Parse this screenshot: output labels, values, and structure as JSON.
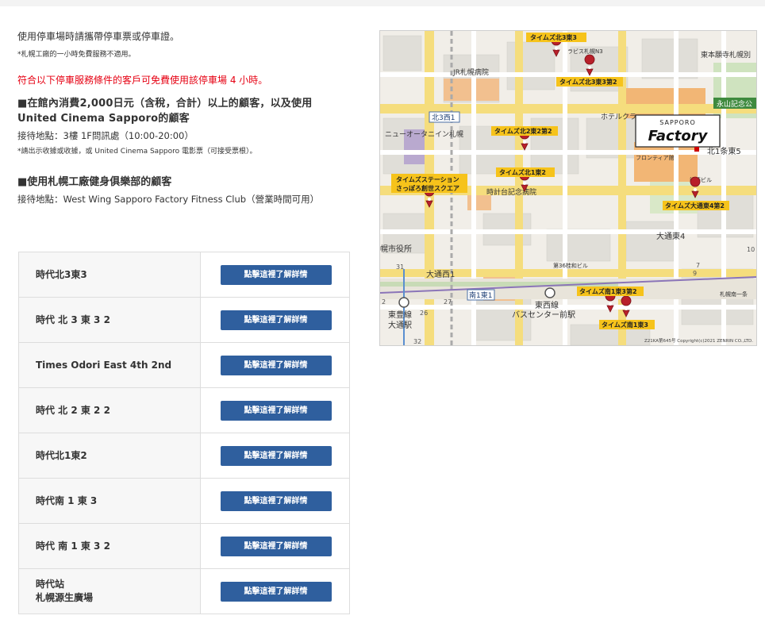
{
  "intro": {
    "line1": "使用停車場時請攜帶停車票或停車證。",
    "note1": "*札幌工廠的一小時免費服務不適用。",
    "red_notice": "符合以下停車服務條件的客戶可免費使用該停車場 4 小時。",
    "cond1_title": "■在館內消費2,000日元（含稅，合計）以上的顧客，以及使用United Cinema Sapporo的顧客",
    "cond1_reception": "接待地點：3樓 1F問訊處（10:00-20:00）",
    "cond1_note": "*請出示收據或收據，或 United Cinema Sapporo 電影票（可接受票根）。",
    "cond2_title": "■使用札幌工廠健身俱樂部的顧客",
    "cond2_reception": "接待地點：West Wing Sapporo Factory Fitness Club（營業時間可用）"
  },
  "parking": {
    "button_label": "點擊這裡了解詳情",
    "rows": [
      {
        "name": "時代北3東3"
      },
      {
        "name": "時代 北 3 東 3 2"
      },
      {
        "name": "Times Odori East 4th 2nd"
      },
      {
        "name": "時代 北 2 東 2 2"
      },
      {
        "name": "時代北1東2"
      },
      {
        "name": "時代南 1 東 3"
      },
      {
        "name": "時代 南 1 東 3 2"
      },
      {
        "name": "時代站\n札幌源生廣場"
      }
    ]
  },
  "map": {
    "logo_top": "SAPPORO",
    "logo_main": "Factory",
    "copyright": "Z21KA第645号 Copyright(c)2021 ZENRIN CO.,LTD.",
    "callouts": {
      "c1": "タイムズ北3東3",
      "c2": "タイムズ北3東3第2",
      "c3": "タイムズ北2東2第2",
      "c4": "タイムズ北1東2",
      "c5a": "タイムズステーション",
      "c5b": "さっぽろ創世スクエア",
      "c6": "タイムズ大通東4第2",
      "c7": "タイムズ南1東3第2",
      "c8": "タイムズ南1東3"
    },
    "places": {
      "p1": "JR札幌病院",
      "p2": "北3西1",
      "p3": "ニューオータニイン札幌",
      "p4": "時計台記念病院",
      "p5": "ホテルクラ",
      "p6": "フロンティア館",
      "p7": "北1条東5",
      "p8": "永山記念公",
      "p9": "東本願寺札幌別",
      "p10": "大通東4",
      "p11": "幌市役所",
      "p12": "大通西1",
      "p13": "南1東1",
      "p14": "東豊線",
      "p15": "大通駅",
      "p16": "東西線",
      "p17": "バスセンター前駅",
      "p18": "第36桂和ビル",
      "p19": "札幌南一条",
      "p20": "ラビス札幌N3",
      "p21": "後藤ビル"
    },
    "route_numbers": {
      "r1": "27",
      "r2": "26",
      "r3": "31",
      "r4": "32",
      "r5": "9",
      "r6": "7",
      "r7": "10",
      "r8": "2"
    }
  }
}
